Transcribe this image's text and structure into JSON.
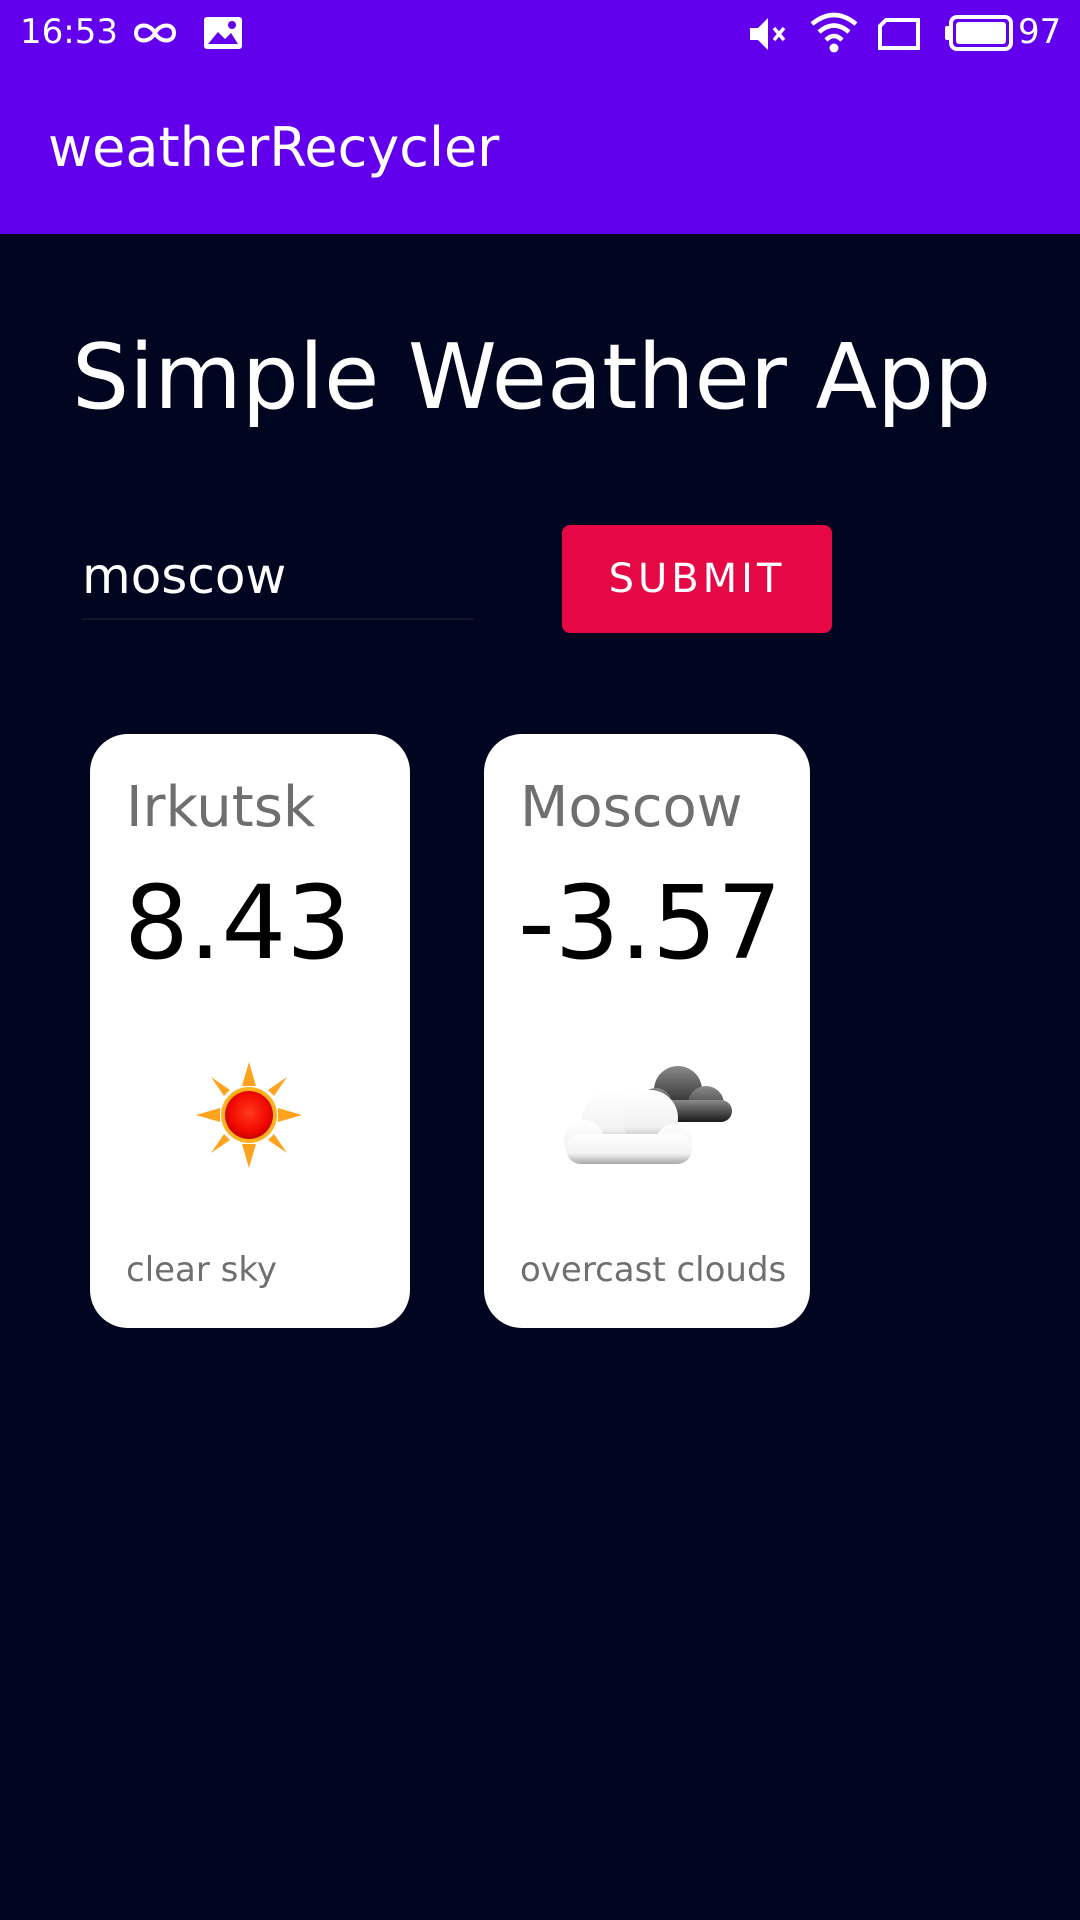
{
  "status_bar": {
    "time": "16:53",
    "icons": [
      "infinity-icon",
      "image-icon",
      "volume-muted-icon",
      "wifi-icon",
      "screen-rotate-icon",
      "battery-icon"
    ],
    "battery_level": "97"
  },
  "app_bar": {
    "title": "weatherRecycler"
  },
  "main": {
    "heading": "Simple Weather App",
    "search": {
      "value": "moscow",
      "placeholder": ""
    },
    "submit_label": "SUBMIT",
    "cards": [
      {
        "city": "Irkutsk",
        "temperature": "8.43",
        "description": "clear sky",
        "icon": "sun-icon"
      },
      {
        "city": "Moscow",
        "temperature": "-3.57",
        "description": "overcast clouds",
        "icon": "cloud-icon"
      }
    ]
  },
  "colors": {
    "primary": "#6200EE",
    "accent": "#E60845",
    "background": "#000520",
    "card": "#FFFFFF"
  }
}
